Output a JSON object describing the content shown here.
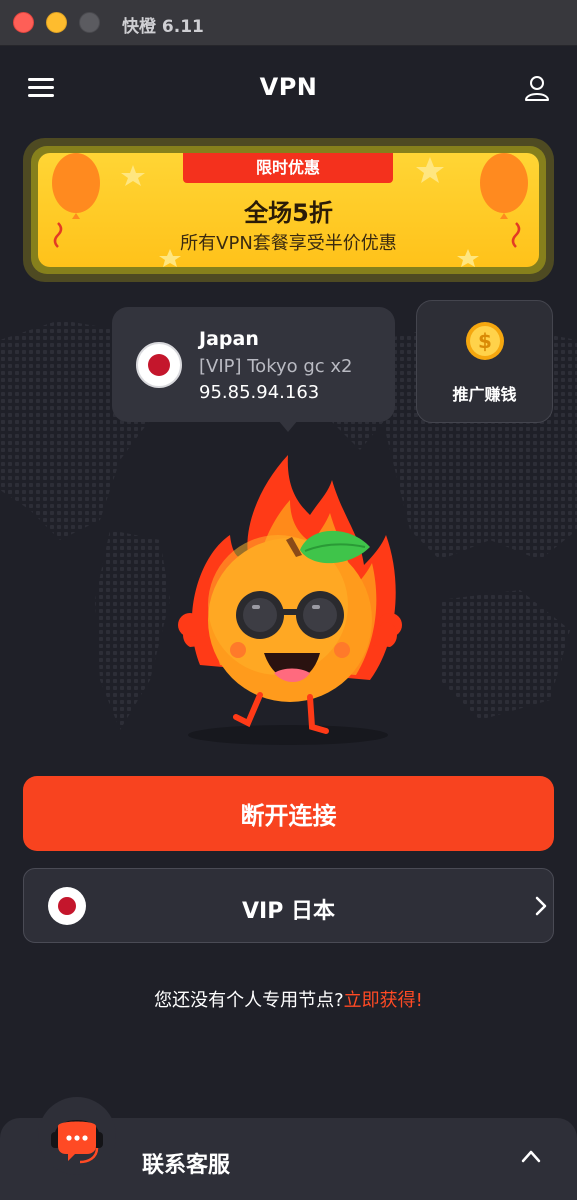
{
  "window": {
    "title": "快橙 6.11"
  },
  "header": {
    "title": "VPN",
    "menu_icon": "hamburger-menu-icon",
    "user_icon": "user-icon"
  },
  "promo": {
    "tag": "限时优惠",
    "headline": "全场5折",
    "subtitle": "所有VPN套餐享受半价优惠"
  },
  "server": {
    "country": "Japan",
    "node": "[VIP] Tokyo gc x2",
    "ip": "95.85.94.163",
    "flag_icon": "japan-flag-icon"
  },
  "earn": {
    "label": "推广赚钱",
    "icon": "coin-icon"
  },
  "connection": {
    "disconnect_label": "断开连接"
  },
  "location": {
    "label": "VIP 日本",
    "flag_icon": "japan-flag-icon"
  },
  "dedicated": {
    "text": "您还没有个人专用节点?",
    "link": "立即获得!"
  },
  "support": {
    "label": "联系客服",
    "icon": "headset-chat-icon"
  },
  "colors": {
    "background": "#1f2028",
    "accent": "#f8431f",
    "card": "#33343d",
    "promo_yellow": "#ffd535",
    "link": "#ff4a24"
  }
}
